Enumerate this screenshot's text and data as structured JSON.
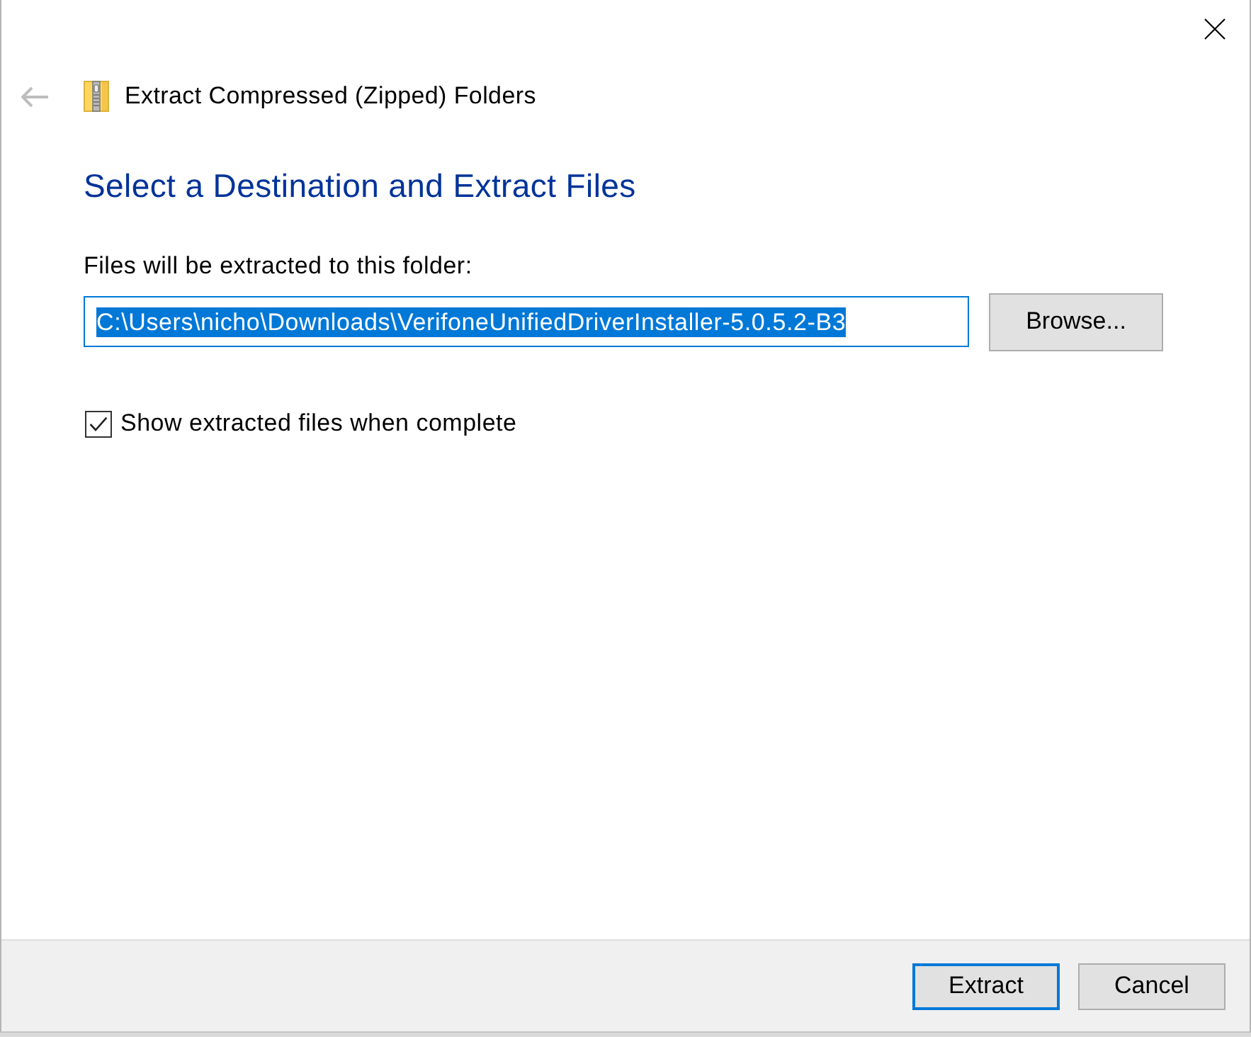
{
  "window": {
    "title": "Extract Compressed (Zipped) Folders",
    "back_button": {
      "disabled": true
    }
  },
  "heading": "Select a Destination and Extract Files",
  "destination": {
    "label": "Files will be extracted to this folder:",
    "value": "C:\\Users\\nicho\\Downloads\\VerifoneUnifiedDriverInstaller-5.0.5.2-B3",
    "selected": true,
    "browse_button": "Browse..."
  },
  "show_files": {
    "label": "Show extracted files when complete",
    "checked": true
  },
  "buttons": [
    {
      "label": "Extract",
      "default": true
    },
    {
      "label": "Cancel",
      "default": false
    }
  ]
}
